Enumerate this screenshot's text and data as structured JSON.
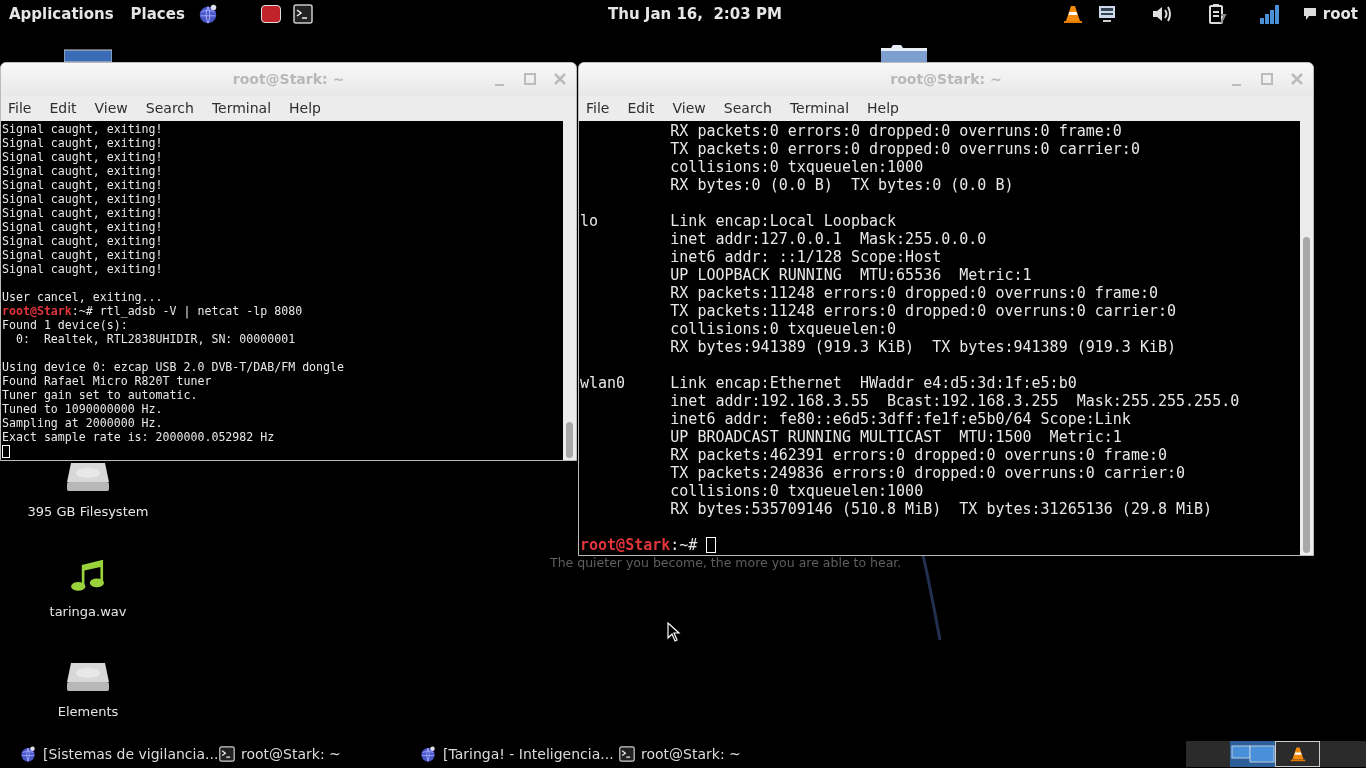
{
  "top_panel": {
    "menus": [
      "Applications",
      "Places"
    ],
    "clock": "Thu Jan 16,  2:03 PM",
    "user": "root"
  },
  "desktop_icons": [
    {
      "label": "395 GB Filesystem",
      "kind": "drive"
    },
    {
      "label": "taringa.wav",
      "kind": "audio"
    },
    {
      "label": "Elements",
      "kind": "drive"
    }
  ],
  "wallpaper": {
    "tagline": "The quieter you become, the more you are able to hear."
  },
  "windows": [
    {
      "title": "root@Stark: ~",
      "menu": [
        "File",
        "Edit",
        "View",
        "Search",
        "Terminal",
        "Help"
      ],
      "lines": [
        {
          "kind": "output",
          "text": "Signal caught, exiting!"
        },
        {
          "kind": "output",
          "text": "Signal caught, exiting!"
        },
        {
          "kind": "output",
          "text": "Signal caught, exiting!"
        },
        {
          "kind": "output",
          "text": "Signal caught, exiting!"
        },
        {
          "kind": "output",
          "text": "Signal caught, exiting!"
        },
        {
          "kind": "output",
          "text": "Signal caught, exiting!"
        },
        {
          "kind": "output",
          "text": "Signal caught, exiting!"
        },
        {
          "kind": "output",
          "text": "Signal caught, exiting!"
        },
        {
          "kind": "output",
          "text": "Signal caught, exiting!"
        },
        {
          "kind": "output",
          "text": "Signal caught, exiting!"
        },
        {
          "kind": "output",
          "text": "Signal caught, exiting!"
        },
        {
          "kind": "blank"
        },
        {
          "kind": "output",
          "text": "User cancel, exiting..."
        },
        {
          "kind": "prompt",
          "user": "root@Stark",
          "path": ":~#",
          "command": "rtl_adsb -V | netcat -lp 8080",
          "cursor": false
        },
        {
          "kind": "output",
          "text": "Found 1 device(s):"
        },
        {
          "kind": "output",
          "text": "  0:  Realtek, RTL2838UHIDIR, SN: 00000001"
        },
        {
          "kind": "blank"
        },
        {
          "kind": "output",
          "text": "Using device 0: ezcap USB 2.0 DVB-T/DAB/FM dongle"
        },
        {
          "kind": "output",
          "text": "Found Rafael Micro R820T tuner"
        },
        {
          "kind": "output",
          "text": "Tuner gain set to automatic."
        },
        {
          "kind": "output",
          "text": "Tuned to 1090000000 Hz."
        },
        {
          "kind": "output",
          "text": "Sampling at 2000000 Hz."
        },
        {
          "kind": "output",
          "text": "Exact sample rate is: 2000000.052982 Hz"
        },
        {
          "kind": "cursor"
        }
      ]
    },
    {
      "title": "root@Stark: ~",
      "menu": [
        "File",
        "Edit",
        "View",
        "Search",
        "Terminal",
        "Help"
      ],
      "lines": [
        {
          "kind": "output",
          "text": "          RX packets:0 errors:0 dropped:0 overruns:0 frame:0"
        },
        {
          "kind": "output",
          "text": "          TX packets:0 errors:0 dropped:0 overruns:0 carrier:0"
        },
        {
          "kind": "output",
          "text": "          collisions:0 txqueuelen:1000"
        },
        {
          "kind": "output",
          "text": "          RX bytes:0 (0.0 B)  TX bytes:0 (0.0 B)"
        },
        {
          "kind": "blank"
        },
        {
          "kind": "output",
          "text": "lo        Link encap:Local Loopback"
        },
        {
          "kind": "output",
          "text": "          inet addr:127.0.0.1  Mask:255.0.0.0"
        },
        {
          "kind": "output",
          "text": "          inet6 addr: ::1/128 Scope:Host"
        },
        {
          "kind": "output",
          "text": "          UP LOOPBACK RUNNING  MTU:65536  Metric:1"
        },
        {
          "kind": "output",
          "text": "          RX packets:11248 errors:0 dropped:0 overruns:0 frame:0"
        },
        {
          "kind": "output",
          "text": "          TX packets:11248 errors:0 dropped:0 overruns:0 carrier:0"
        },
        {
          "kind": "output",
          "text": "          collisions:0 txqueuelen:0"
        },
        {
          "kind": "output",
          "text": "          RX bytes:941389 (919.3 KiB)  TX bytes:941389 (919.3 KiB)"
        },
        {
          "kind": "blank"
        },
        {
          "kind": "output",
          "text": "wlan0     Link encap:Ethernet  HWaddr e4:d5:3d:1f:e5:b0"
        },
        {
          "kind": "output",
          "text": "          inet addr:192.168.3.55  Bcast:192.168.3.255  Mask:255.255.255.0"
        },
        {
          "kind": "output",
          "text": "          inet6 addr: fe80::e6d5:3dff:fe1f:e5b0/64 Scope:Link"
        },
        {
          "kind": "output",
          "text": "          UP BROADCAST RUNNING MULTICAST  MTU:1500  Metric:1"
        },
        {
          "kind": "output",
          "text": "          RX packets:462391 errors:0 dropped:0 overruns:0 frame:0"
        },
        {
          "kind": "output",
          "text": "          TX packets:249836 errors:0 dropped:0 overruns:0 carrier:0"
        },
        {
          "kind": "output",
          "text": "          collisions:0 txqueuelen:1000"
        },
        {
          "kind": "output",
          "text": "          RX bytes:535709146 (510.8 MiB)  TX bytes:31265136 (29.8 MiB)"
        },
        {
          "kind": "blank"
        },
        {
          "kind": "prompt",
          "user": "root@Stark",
          "path": ":~#",
          "cursor": true
        }
      ]
    }
  ],
  "taskbar": {
    "items": [
      {
        "kind": "browser",
        "label": "[Sistemas de vigilancia..."
      },
      {
        "kind": "terminal",
        "label": "root@Stark: ~"
      },
      {
        "kind": "browser",
        "label": "[Taringa! - Inteligencia..."
      },
      {
        "kind": "terminal",
        "label": "root@Stark: ~"
      }
    ],
    "workspaces": [
      {
        "selected": true,
        "kind": "windows"
      },
      {
        "selected": false,
        "kind": "vlc"
      }
    ]
  }
}
